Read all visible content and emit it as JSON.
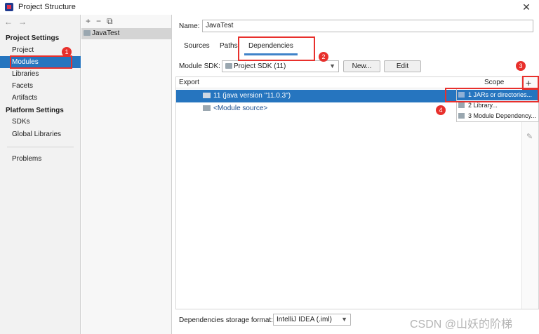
{
  "window": {
    "title": "Project Structure",
    "close_glyph": "✕"
  },
  "left_nav": {
    "back_glyph": "←",
    "forward_glyph": "→",
    "project_settings_header": "Project Settings",
    "items_project": [
      "Project",
      "Modules",
      "Libraries",
      "Facets",
      "Artifacts"
    ],
    "platform_settings_header": "Platform Settings",
    "items_platform": [
      "SDKs",
      "Global Libraries"
    ],
    "problems": "Problems",
    "selected": "Modules"
  },
  "module_list": {
    "toolbar": {
      "add": "+",
      "remove": "−",
      "copy": "⧉"
    },
    "modules": [
      "JavaTest"
    ]
  },
  "module_editor": {
    "name_label": "Name:",
    "name_value": "JavaTest",
    "tabs": [
      "Sources",
      "Paths",
      "Dependencies"
    ],
    "active_tab": "Dependencies",
    "sdk_label": "Module SDK:",
    "sdk_value": "Project SDK (11)",
    "new_button": "New...",
    "edit_button": "Edit",
    "table_header_export": "Export",
    "table_header_scope": "Scope",
    "rows": [
      {
        "label": "11 (java version \"11.0.3\")",
        "selected": true
      },
      {
        "label": "<Module source>",
        "selected": false
      }
    ],
    "add_glyph": "+",
    "edit_glyph": "✎",
    "storage_label": "Dependencies storage format:",
    "storage_value": "IntelliJ IDEA (.iml)"
  },
  "add_popup": {
    "items": [
      "1  JARs or directories...",
      "2  Library...",
      "3  Module Dependency..."
    ],
    "selected_index": 0
  },
  "annotations": [
    "1",
    "2",
    "3",
    "4"
  ],
  "watermark": "CSDN @山妖的阶梯",
  "colors": {
    "selection": "#2675bf",
    "highlight_red": "#e8302c",
    "tab_underline": "#4083c9",
    "sidebar_bg": "#f2f2f2"
  }
}
